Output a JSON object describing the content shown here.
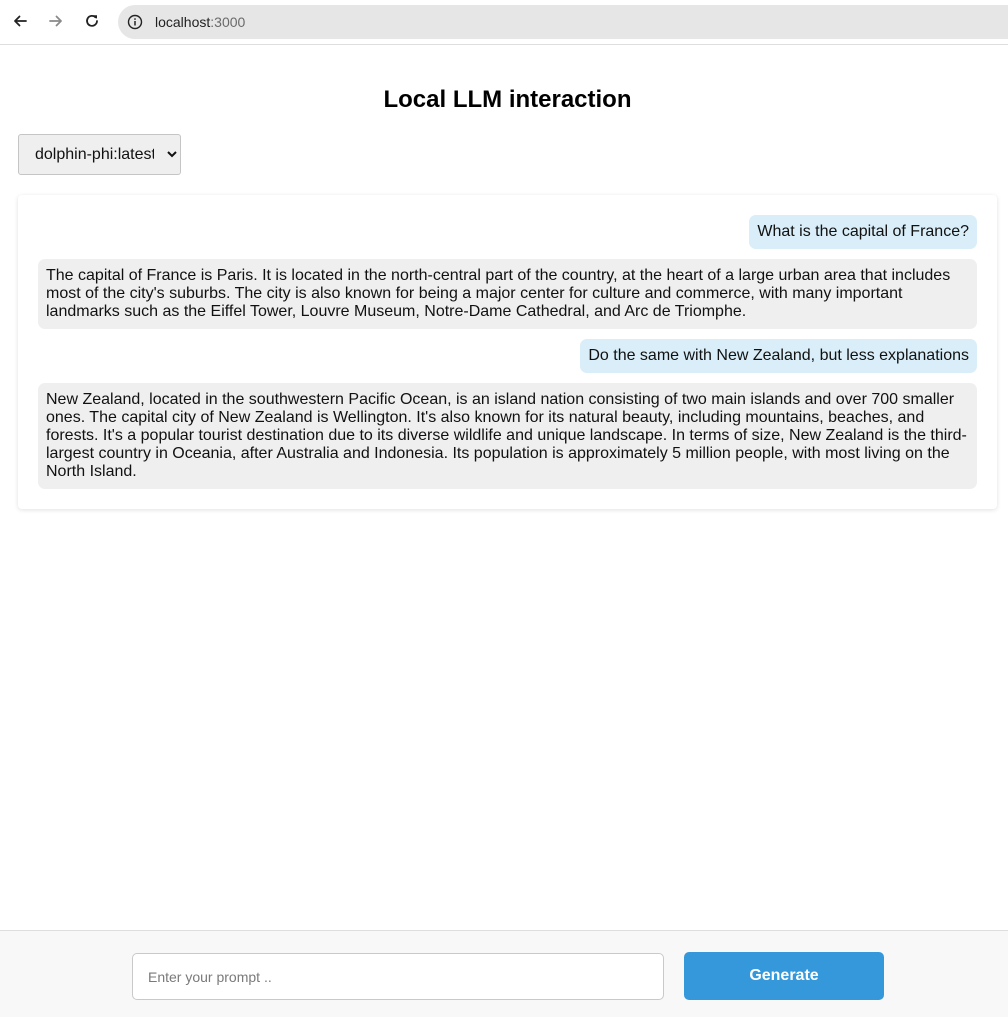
{
  "browser": {
    "url_host": "localhost",
    "url_port": ":3000"
  },
  "page": {
    "title": "Local LLM interaction"
  },
  "model_select": {
    "selected": "dolphin-phi:latest"
  },
  "messages": [
    {
      "role": "user",
      "text": "What is the capital of France?"
    },
    {
      "role": "assistant",
      "text": "The capital of France is Paris. It is located in the north-central part of the country, at the heart of a large urban area that includes most of the city's suburbs. The city is also known for being a major center for culture and commerce, with many important landmarks such as the Eiffel Tower, Louvre Museum, Notre-Dame Cathedral, and Arc de Triomphe."
    },
    {
      "role": "user",
      "text": "Do the same with New Zealand, but less explanations"
    },
    {
      "role": "assistant",
      "text": "New Zealand, located in the southwestern Pacific Ocean, is an island nation consisting of two main islands and over 700 smaller ones. The capital city of New Zealand is Wellington. It's also known for its natural beauty, including mountains, beaches, and forests. It's a popular tourist destination due to its diverse wildlife and unique landscape. In terms of size, New Zealand is the third-largest country in Oceania, after Australia and Indonesia. Its population is approximately 5 million people, with most living on the North Island."
    }
  ],
  "prompt": {
    "placeholder": "Enter your prompt ..",
    "value": ""
  },
  "generate_button": {
    "label": "Generate"
  },
  "colors": {
    "user_bubble": "#d9eef8",
    "assistant_bubble": "#efefef",
    "accent": "#3498db"
  }
}
